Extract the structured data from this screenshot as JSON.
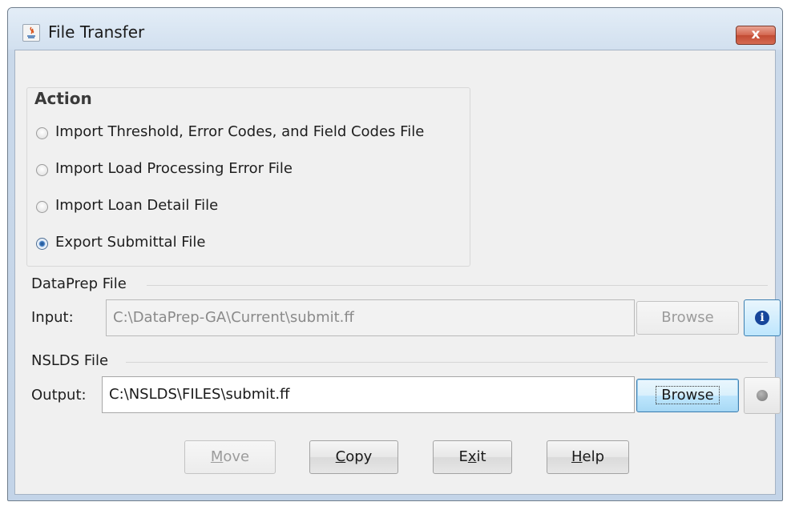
{
  "window": {
    "title": "File Transfer",
    "close_glyph": "x"
  },
  "action": {
    "title": "Action",
    "options": [
      {
        "label": "Import Threshold, Error Codes, and Field Codes File",
        "selected": false
      },
      {
        "label": "Import Load Processing Error File",
        "selected": false
      },
      {
        "label": "Import Loan Detail File",
        "selected": false
      },
      {
        "label": "Export Submittal File",
        "selected": true
      }
    ]
  },
  "dataprep": {
    "title": "DataPrep File",
    "input_label": "Input:",
    "input_value": "C:\\DataPrep-GA\\Current\\submit.ff",
    "browse_label": "Browse",
    "info_icon": "info-icon"
  },
  "nslds": {
    "title": "NSLDS File",
    "output_label": "Output:",
    "output_value": "C:\\NSLDS\\FILES\\submit.ff",
    "browse_label": "Browse",
    "status_icon": "status-dot-icon"
  },
  "buttons": {
    "move": {
      "mnemonic": "M",
      "rest": "ove"
    },
    "copy": {
      "mnemonic": "C",
      "rest": "opy"
    },
    "exit": {
      "pre": "E",
      "mnemonic": "x",
      "rest": "it"
    },
    "help": {
      "mnemonic": "H",
      "rest": "elp"
    }
  },
  "colors": {
    "accent": "#3c7fb1",
    "info": "#17469a",
    "close": "#c24b33"
  }
}
